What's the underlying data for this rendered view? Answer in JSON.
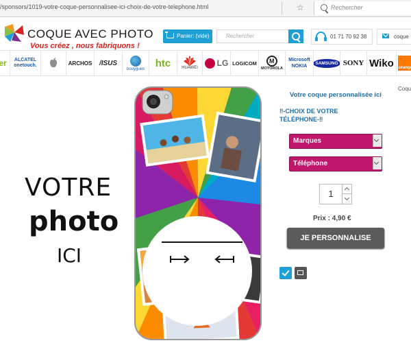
{
  "browser": {
    "url": "/sponsors/1019-votre-coque-personnalisee-ici-choix-de-votre-telephone.html",
    "search_placeholder": "Rechercher"
  },
  "header": {
    "logo_title": "COQUE AVEC PHOTO",
    "logo_subtitle": "Vous créez , nous fabriquons !",
    "cart_label": "Panier: (vide)",
    "search_placeholder": "Rechercher",
    "phone_number": "01 71 70 92 38",
    "contact_label": "coque"
  },
  "brands": [
    {
      "name": "acer",
      "label": "er"
    },
    {
      "name": "alcatel",
      "label": "ALCATEL onetouch."
    },
    {
      "name": "apple",
      "label": ""
    },
    {
      "name": "archos",
      "label": "ARCHOS"
    },
    {
      "name": "asus",
      "label": "/ISUS"
    },
    {
      "name": "bouygues",
      "label": "bouygues"
    },
    {
      "name": "htc",
      "label": "htc"
    },
    {
      "name": "huawei",
      "label": "HUAWEI"
    },
    {
      "name": "lg",
      "label": "LG"
    },
    {
      "name": "logicom",
      "label": "LOGICOM"
    },
    {
      "name": "motorola",
      "label": "MOTOROLA"
    },
    {
      "name": "microsoft-nokia",
      "label": "Microsoft NOKIA"
    },
    {
      "name": "samsung",
      "label": "SAMSUNG"
    },
    {
      "name": "sony",
      "label": "SONY"
    },
    {
      "name": "wiko",
      "label": "Wiko"
    },
    {
      "name": "orange",
      "label": "orange"
    }
  ],
  "product": {
    "title": "Votre coque personnalisée ici",
    "choice_title": "‼-CHOIX DE VOTRE TÉLÉPHONE-‼",
    "brand_select": "Marques",
    "phone_select": "Téléphone",
    "quantity": "1",
    "price": "Prix : 4,90 €",
    "personalise_button": "JE PERSONNALISE",
    "side_label": "Coqu",
    "case_text": {
      "line1": "VOTRE",
      "line2": "photo",
      "line3": "ICI"
    }
  },
  "colors": {
    "accent": "#1e9fd6",
    "select": "#c0176a",
    "title_blue": "#1e6fa8",
    "logo_red": "#d6231f",
    "button_gray": "#5b5b5b"
  }
}
